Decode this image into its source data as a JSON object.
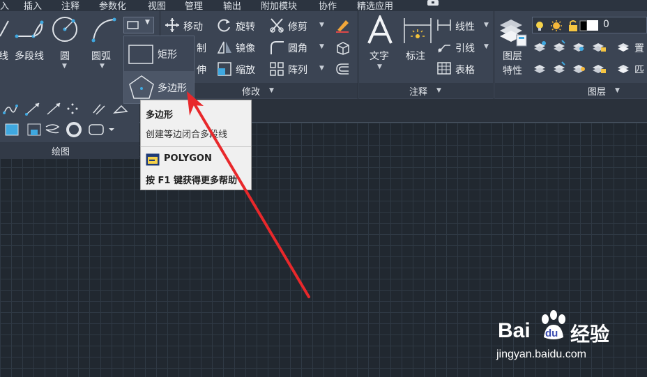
{
  "menu_tabs": [
    "入",
    "插入",
    "注释",
    "参数化",
    "视图",
    "管理",
    "输出",
    "附加模块",
    "协作",
    "精选应用"
  ],
  "draw_panel": {
    "tools": [
      "线",
      "多段线",
      "圆",
      "圆弧"
    ],
    "title": "绘图"
  },
  "rect_dropdown": {
    "items": [
      "矩形",
      "多边形"
    ]
  },
  "modify_panel": {
    "items": [
      "移动",
      "旋转",
      "修剪",
      "制",
      "镜像",
      "圆角",
      "伸",
      "缩放",
      "阵列"
    ],
    "title": "修改"
  },
  "annotation_panel": {
    "big": [
      "文字",
      "标注"
    ],
    "items": [
      "线性",
      "引线",
      "表格"
    ],
    "title": "注释"
  },
  "layers_panel": {
    "big_line1": "图层",
    "big_line2": "特性",
    "current_layer": "0",
    "side": [
      "置",
      "匹"
    ],
    "title": "图层"
  },
  "tooltip": {
    "title": "多边形",
    "description": "创建等边闭合多段线",
    "command": "POLYGON",
    "help": "按 F1 键获得更多帮助"
  },
  "watermark": {
    "brand": "Bai",
    "brand2": "du",
    "cn": "经验",
    "url": "jingyan.baidu.com"
  },
  "colors": {
    "ribbon": "#3b4453",
    "canvas": "#212830",
    "accent": "#3fa8e0",
    "arrow": "#e8282b",
    "tooltip_bg": "#f0f0f0"
  }
}
